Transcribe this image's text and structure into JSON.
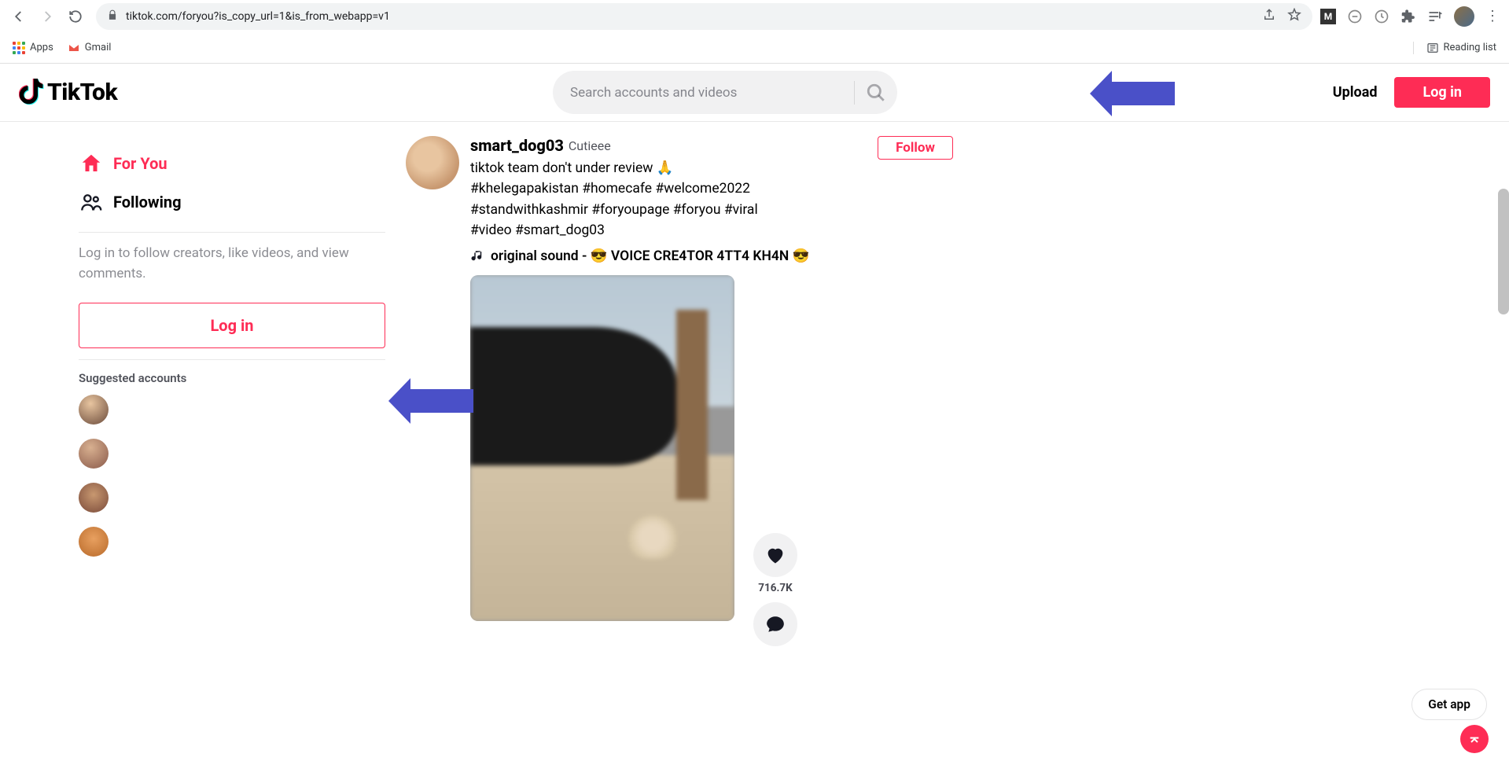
{
  "browser": {
    "url": "tiktok.com/foryou?is_copy_url=1&is_from_webapp=v1",
    "bookmarks": {
      "apps": "Apps",
      "gmail": "Gmail",
      "reading_list": "Reading list"
    }
  },
  "header": {
    "logo_text": "TikTok",
    "search_placeholder": "Search accounts and videos",
    "upload": "Upload",
    "login": "Log in"
  },
  "sidebar": {
    "for_you": "For You",
    "following": "Following",
    "prompt": "Log in to follow creators, like videos, and view comments.",
    "login": "Log in",
    "suggested_heading": "Suggested accounts"
  },
  "post": {
    "username": "smart_dog03",
    "nickname": "Cutieee",
    "caption": "tiktok team don't under review 🙏 #khelegapakistan #homecafe #welcome2022 #standwithkashmir #foryoupage #foryou #viral #video #smart_dog03",
    "sound": "original sound - 😎 VOICE CRE4TOR 4TT4 KH4N 😎",
    "follow": "Follow",
    "likes": "716.7K"
  },
  "floating": {
    "get_app": "Get app"
  }
}
